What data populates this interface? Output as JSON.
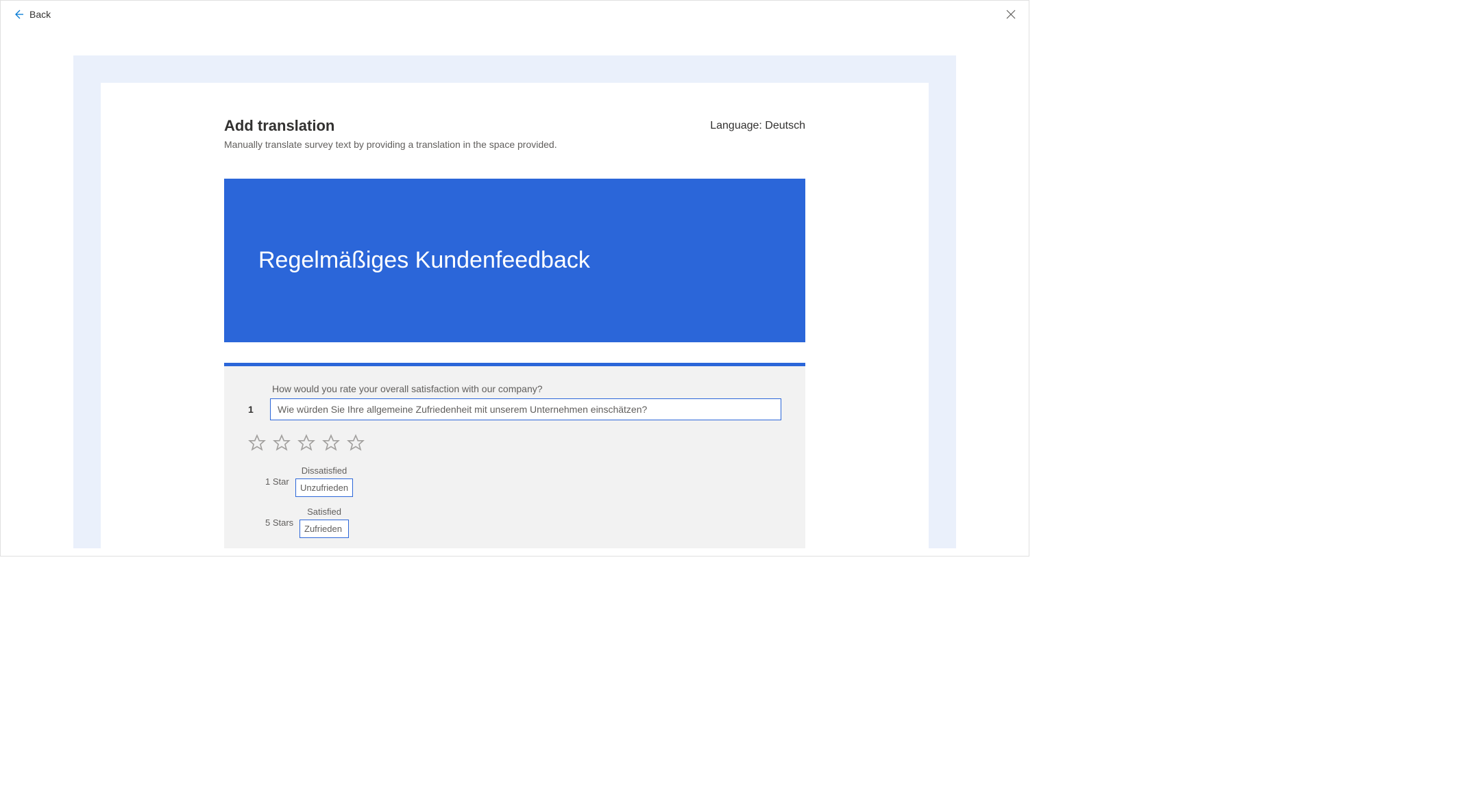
{
  "topbar": {
    "back_label": "Back"
  },
  "header": {
    "title": "Add translation",
    "subtitle": "Manually translate survey text by providing a translation in the space provided.",
    "language_prefix": "Language: ",
    "language_value": "Deutsch"
  },
  "survey": {
    "title_translation": "Regelmäßiges Kundenfeedback"
  },
  "question1": {
    "number": "1",
    "original": "How would you rate your overall satisfaction with our company?",
    "translation": "Wie würden Sie Ihre allgemeine Zufriedenheit mit unserem Unternehmen einschätzen?",
    "low_star_label": "1 Star",
    "low_original": "Dissatisfied",
    "low_translation": "Unzufrieden",
    "high_star_label": "5 Stars",
    "high_original": "Satisfied",
    "high_translation": "Zufrieden"
  }
}
